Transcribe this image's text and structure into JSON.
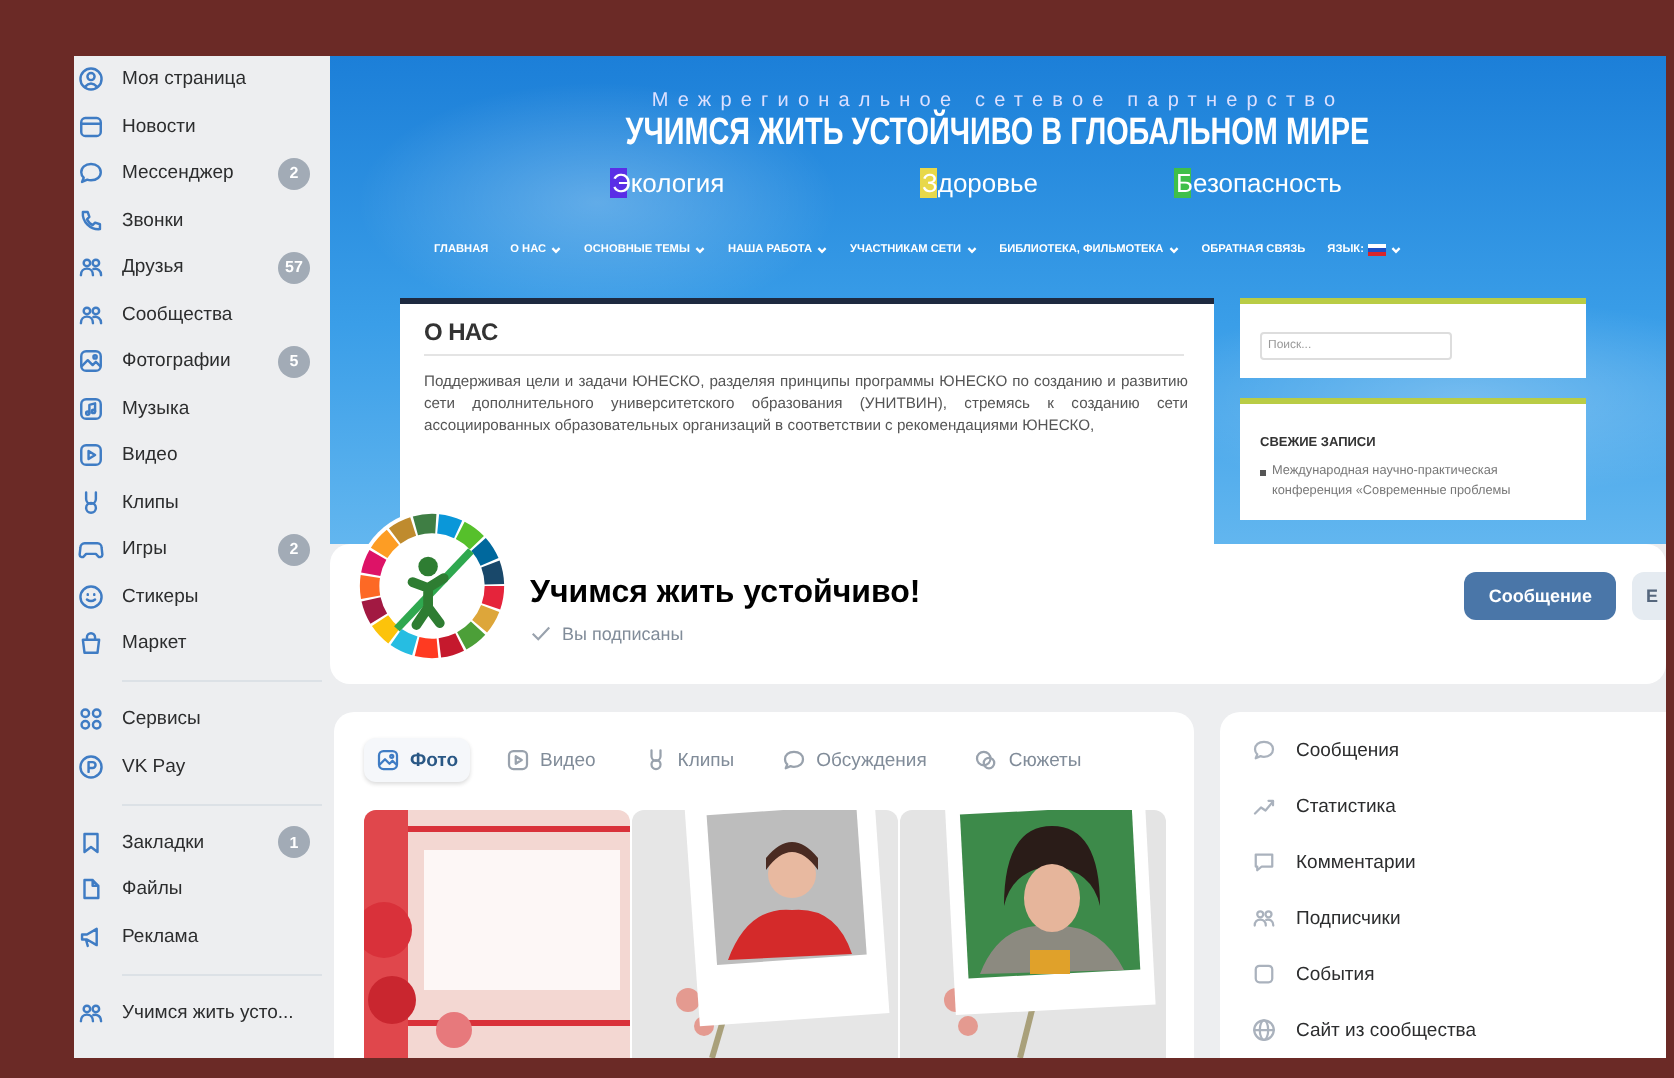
{
  "sidebar": {
    "groups": [
      {
        "items": [
          {
            "label": "Моя страница"
          },
          {
            "label": "Новости"
          },
          {
            "label": "Мессенджер",
            "badge": "2"
          },
          {
            "label": "Звонки"
          },
          {
            "label": "Друзья",
            "badge": "57"
          },
          {
            "label": "Сообщества"
          },
          {
            "label": "Фотографии",
            "badge": "5"
          },
          {
            "label": "Музыка"
          },
          {
            "label": "Видео"
          },
          {
            "label": "Клипы"
          },
          {
            "label": "Игры",
            "badge": "2"
          },
          {
            "label": "Стикеры"
          },
          {
            "label": "Маркет"
          }
        ]
      },
      {
        "items": [
          {
            "label": "Сервисы"
          },
          {
            "label": "VK Pay"
          }
        ]
      },
      {
        "items": [
          {
            "label": "Закладки",
            "badge": "1"
          },
          {
            "label": "Файлы"
          },
          {
            "label": "Реклама"
          }
        ]
      },
      {
        "items": [
          {
            "label": "Учимся жить усто..."
          }
        ]
      }
    ]
  },
  "cover": {
    "tagline": "Межрегиональное сетевое партнерство",
    "title": "УЧИМСЯ ЖИТЬ УСТОЙЧИВО В ГЛОБАЛЬНОМ МИРЕ",
    "themes": [
      {
        "text": "Экология",
        "color": "#5a2ee6"
      },
      {
        "text": "Здоровье",
        "color": "#e8d84a"
      },
      {
        "text": "Безопасность",
        "color": "#3fbf4a"
      }
    ],
    "nav": [
      {
        "label": "ГЛАВНАЯ",
        "kind": "link",
        "dropdown": false
      },
      {
        "label": "О НАС",
        "kind": "link",
        "dropdown": true
      },
      {
        "label": "ОСНОВНЫЕ ТЕМЫ",
        "kind": "link",
        "dropdown": true
      },
      {
        "label": "НАША РАБОТА",
        "kind": "link",
        "dropdown": true
      },
      {
        "label": "УЧАСТНИКАМ СЕТИ",
        "kind": "link",
        "dropdown": true
      },
      {
        "label": "БИБЛИОТЕКА, ФИЛЬМОТЕКА",
        "kind": "link",
        "dropdown": true
      },
      {
        "label": "ОБРАТНАЯ СВЯЗЬ",
        "kind": "link",
        "dropdown": false
      },
      {
        "label": "ЯЗЫК:",
        "kind": "language",
        "dropdown": true
      }
    ],
    "about": {
      "heading": "О НАС",
      "text": "Поддерживая цели и задачи ЮНЕСКО, разделяя принципы программы ЮНЕСКО по созданию и развитию сети дополнительного университетского образования (УНИТВИН), стремясь к созданию сети ассоциированных образовательных организаций в соответствии с рекомендациями ЮНЕСКО,"
    },
    "search": {
      "placeholder": "Поиск..."
    },
    "recent": {
      "heading": "СВЕЖИЕ ЗАПИСИ",
      "items": [
        "Международная научно-практическая конференция «Современные проблемы"
      ]
    }
  },
  "group": {
    "name": "Учимся жить устойчиво!",
    "status": "Вы подписаны",
    "buttons": [
      {
        "label": "Сообщение",
        "kind": "primary"
      },
      {
        "label": "Е",
        "kind": "secondary"
      }
    ]
  },
  "media_tabs": [
    {
      "label": "Фото",
      "selected": true
    },
    {
      "label": "Видео",
      "selected": false
    },
    {
      "label": "Клипы",
      "selected": false
    },
    {
      "label": "Обсуждения",
      "selected": false
    },
    {
      "label": "Сюжеты",
      "selected": false
    }
  ],
  "manage_menu": [
    {
      "label": "Сообщения"
    },
    {
      "label": "Статистика"
    },
    {
      "label": "Комментарии"
    },
    {
      "label": "Подписчики"
    },
    {
      "label": "События"
    },
    {
      "label": "Сайт из сообщества"
    }
  ]
}
